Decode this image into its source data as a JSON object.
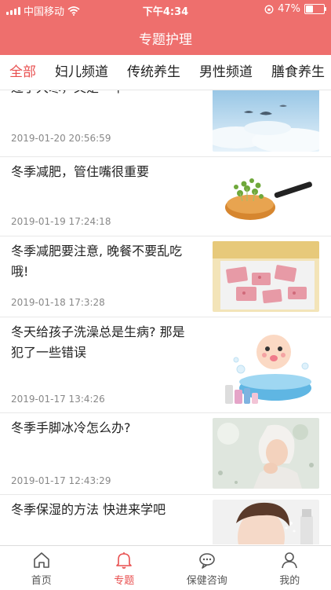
{
  "status_bar": {
    "carrier": "中国移动",
    "time": "下午4:34",
    "battery_text": "47%",
    "battery_level": 0.47
  },
  "nav": {
    "title": "专题护理"
  },
  "tabs": [
    {
      "label": "全部",
      "active": true
    },
    {
      "label": "妇儿频道",
      "active": false
    },
    {
      "label": "传统养生",
      "active": false
    },
    {
      "label": "男性频道",
      "active": false
    },
    {
      "label": "膳食养生",
      "active": false
    }
  ],
  "articles": [
    {
      "title": "过了大寒，又是一年",
      "time": "2019-01-20 20:56:59",
      "image": "sky-birds"
    },
    {
      "title": "冬季减肥，管住嘴很重要",
      "time": "2019-01-19 17:24:18",
      "image": "sprouts-pan"
    },
    {
      "title": "冬季减肥要注意, 晚餐不要乱吃哦!",
      "time": "2019-01-18 17:3:28",
      "image": "pink-dessert"
    },
    {
      "title": "冬天给孩子洗澡总是生病? 那是犯了一些错误",
      "time": "2019-01-17 13:4:26",
      "image": "baby-bath"
    },
    {
      "title": "冬季手脚冰冷怎么办?",
      "time": "2019-01-17 12:43:29",
      "image": "woman-winter"
    },
    {
      "title": "冬季保湿的方法 快进来学吧",
      "time": "",
      "image": "skincare-spray"
    }
  ],
  "tabbar": [
    {
      "label": "首页",
      "icon": "home-icon",
      "active": false
    },
    {
      "label": "专题",
      "icon": "bell-icon",
      "active": true
    },
    {
      "label": "保健咨询",
      "icon": "chat-icon",
      "active": false
    },
    {
      "label": "我的",
      "icon": "person-icon",
      "active": false
    }
  ],
  "colors": {
    "brand": "#ee6f6d",
    "active_text": "#e84f4f"
  }
}
